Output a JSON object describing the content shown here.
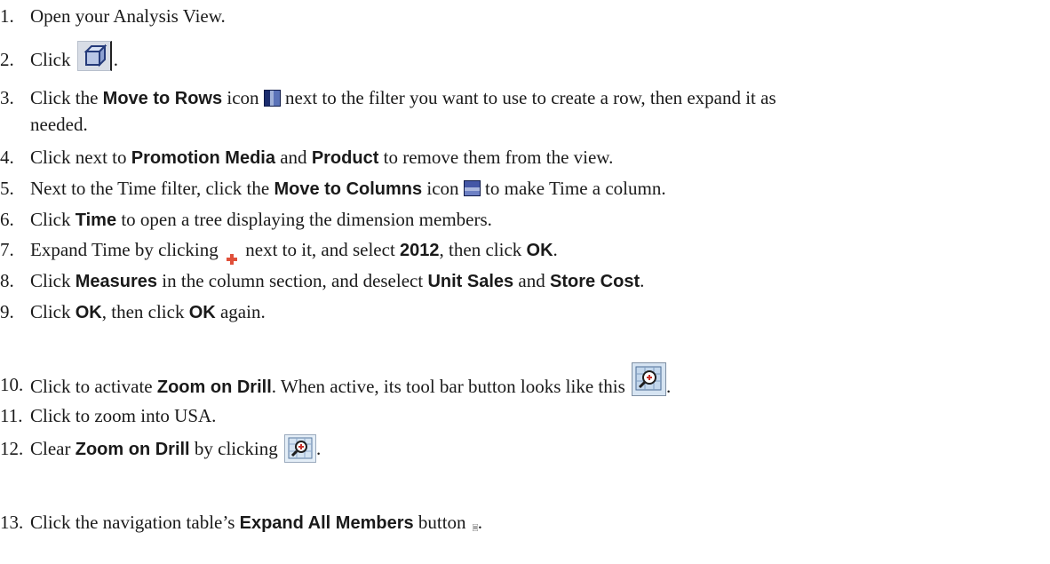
{
  "steps": [
    {
      "num": "1.",
      "parts": [
        "Open your Analysis View."
      ]
    },
    {
      "num": "2.",
      "pre": "Click",
      "post": "."
    },
    {
      "num": "3.",
      "a": "Click the ",
      "b": "Move to Rows",
      "c": " icon ",
      "d": " next to the filter you want to use to create a row, then expand it as",
      "cont": "needed."
    },
    {
      "num": "4.",
      "a": "Click next to ",
      "b": "Promotion Media",
      "c": " and ",
      "d": "Product",
      "e": " to remove them from the view."
    },
    {
      "num": "5.",
      "a": "Next to the Time filter, click the ",
      "b": "Move to Columns",
      "c": " icon ",
      "d": " to make Time a column."
    },
    {
      "num": "6.",
      "a": "Click ",
      "b": "Time",
      "c": " to open a tree displaying the dimension members."
    },
    {
      "num": "7.",
      "a": "Expand Time by clicking ",
      "b": " next to it, and select ",
      "c": "2012",
      "d": ", then click ",
      "e": "OK",
      "f": "."
    },
    {
      "num": "8.",
      "a": "Click ",
      "b": "Measures",
      "c": " in the column section, and deselect ",
      "d": "Unit Sales",
      "e": " and ",
      "f": "Store Cost",
      "g": "."
    },
    {
      "num": "9.",
      "a": "Click ",
      "b": "OK",
      "c": ", then click ",
      "d": "OK",
      "e": " again."
    },
    {
      "num": "10.",
      "a": "Click to activate ",
      "b": "Zoom on Drill",
      "c": ". When active, its tool bar button looks like this",
      "d": "."
    },
    {
      "num": "11.",
      "a": "Click to zoom into USA."
    },
    {
      "num": "12.",
      "a": "Clear ",
      "b": "Zoom on Drill",
      "c": " by clicking",
      "d": "."
    },
    {
      "num": "13.",
      "a": "Click the navigation table’s ",
      "b": "Expand All Members",
      "c": " button ",
      "d": "."
    }
  ],
  "icons": {
    "cube": "cube-icon",
    "rows": "move-to-rows-icon",
    "columns": "move-to-columns-icon",
    "expand": "plus-icon",
    "zoom": "zoom-on-drill-icon",
    "expand_all": "expand-all-members-icon"
  }
}
